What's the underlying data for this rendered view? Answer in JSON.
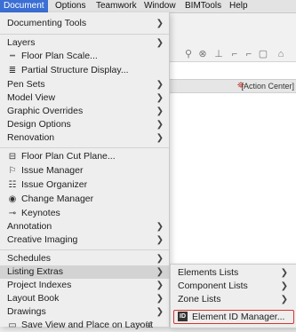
{
  "menubar": {
    "items": [
      {
        "label": "Document",
        "active": true
      },
      {
        "label": "Options"
      },
      {
        "label": "Teamwork"
      },
      {
        "label": "Window"
      },
      {
        "label": "BIMTools"
      },
      {
        "label": "Help"
      }
    ]
  },
  "toolbar": {
    "action_center_label": "[Action Center]"
  },
  "document_menu": {
    "items": [
      {
        "label": "Documenting Tools",
        "submenu": true
      },
      {
        "label": "Layers",
        "submenu": true
      },
      {
        "label": "Floor Plan Scale...",
        "icon": "scale-icon"
      },
      {
        "label": "Partial Structure Display...",
        "icon": "partial-structure-icon"
      },
      {
        "label": "Pen Sets",
        "submenu": true
      },
      {
        "label": "Model View",
        "submenu": true
      },
      {
        "label": "Graphic Overrides",
        "submenu": true
      },
      {
        "label": "Design Options",
        "submenu": true
      },
      {
        "label": "Renovation",
        "submenu": true
      },
      {
        "label": "Floor Plan Cut Plane...",
        "icon": "cut-plane-icon"
      },
      {
        "label": "Issue Manager",
        "icon": "flag-icon"
      },
      {
        "label": "Issue Organizer",
        "icon": "organizer-icon"
      },
      {
        "label": "Change Manager",
        "icon": "change-icon"
      },
      {
        "label": "Keynotes",
        "icon": "keynote-icon"
      },
      {
        "label": "Annotation",
        "submenu": true
      },
      {
        "label": "Creative Imaging",
        "submenu": true
      },
      {
        "label": "Schedules",
        "submenu": true
      },
      {
        "label": "Listing Extras",
        "submenu": true,
        "highlighted": true
      },
      {
        "label": "Project Indexes",
        "submenu": true
      },
      {
        "label": "Layout Book",
        "submenu": true
      },
      {
        "label": "Drawings",
        "submenu": true
      },
      {
        "label": "Save View and Place on Layout",
        "icon": "save-view-icon",
        "shortcut": "⌥⌘"
      }
    ]
  },
  "listing_extras_submenu": {
    "items": [
      {
        "label": "Elements Lists",
        "submenu": true
      },
      {
        "label": "Component Lists",
        "submenu": true
      },
      {
        "label": "Zone Lists",
        "submenu": true
      },
      {
        "label": "Element ID Manager...",
        "icon": "id-icon",
        "icon_text": "ID",
        "boxed": true
      }
    ]
  },
  "colors": {
    "menubar_active": "#3b6fd4",
    "highlight": "#d3d3d3",
    "box_border": "#d9342b"
  }
}
